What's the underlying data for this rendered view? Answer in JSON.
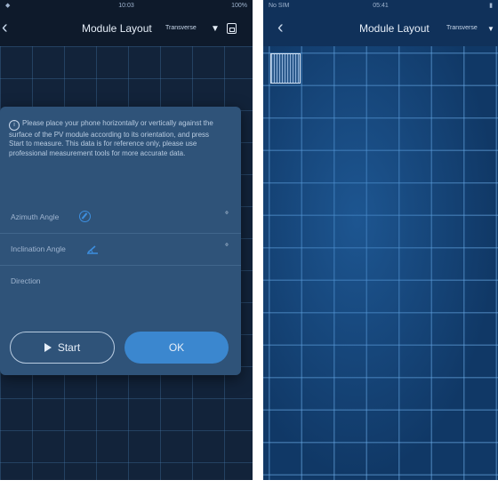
{
  "left_screen": {
    "status_bar": {
      "time": "10:03",
      "battery": "100%"
    },
    "nav": {
      "title": "Module Layout",
      "mode": "Transverse"
    },
    "dialog": {
      "notice": "Please place your phone horizontally or vertically against the surface of the PV module according to its orientation, and press Start to measure. This data is for reference only, please use professional measurement tools for more accurate data.",
      "rows": [
        {
          "label": "Azimuth Angle",
          "value": "°"
        },
        {
          "label": "Inclination Angle",
          "value": "°"
        },
        {
          "label": "Direction",
          "value": ""
        }
      ],
      "start_label": "Start",
      "ok_label": "OK"
    }
  },
  "right_screen": {
    "status_bar": {
      "carrier": "No SIM",
      "time": "05:41"
    },
    "nav": {
      "title": "Module Layout",
      "mode": "Transverse"
    }
  },
  "colors": {
    "accent": "#3b87cf",
    "dialog_bg": "#2f5379",
    "grid_line": "#6eafeb"
  }
}
